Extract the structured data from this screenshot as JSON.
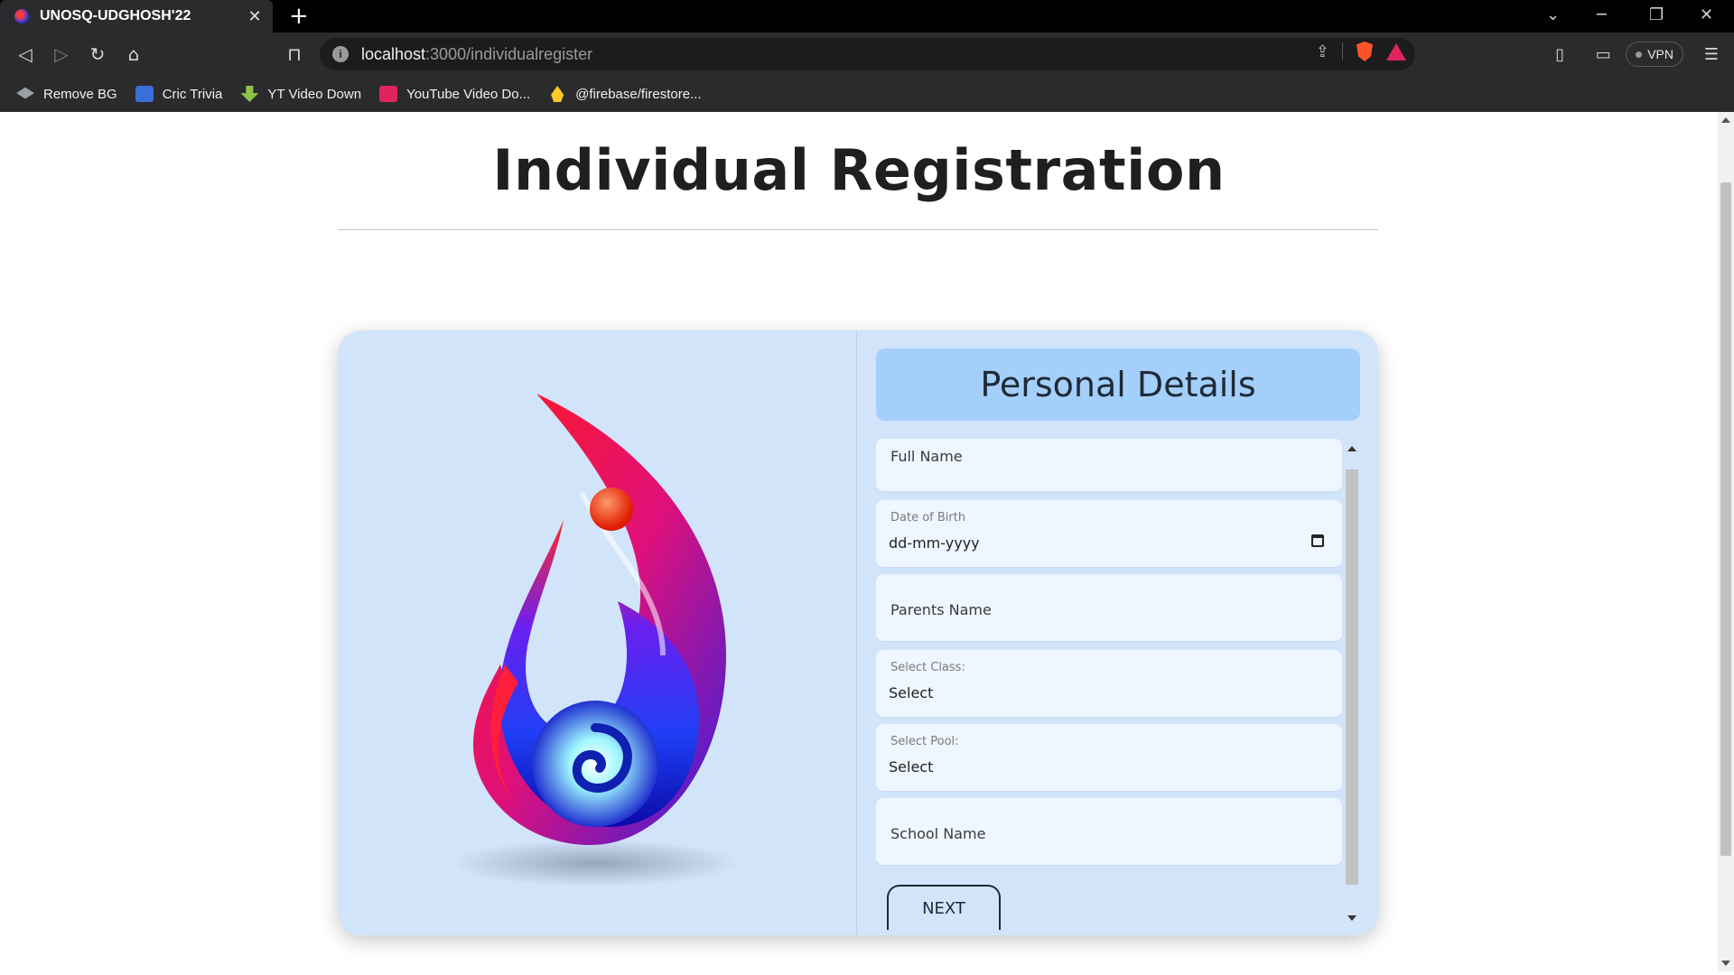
{
  "browser": {
    "tab_title": "UNOSQ-UDGHOSH'22",
    "url_host": "localhost",
    "url_path": ":3000/individualregister",
    "vpn_label": "VPN",
    "bookmarks": [
      {
        "label": "Remove BG",
        "icon": "layers-icon",
        "color": "#9aa0a6"
      },
      {
        "label": "Cric Trivia",
        "icon": "cric-trivia-icon",
        "color": "#3b6fd8"
      },
      {
        "label": "YT Video Down",
        "icon": "download-arrow-icon",
        "color": "#8bc34a"
      },
      {
        "label": "YouTube Video Do...",
        "icon": "youtube-download-icon",
        "color": "#e0245e"
      },
      {
        "label": "@firebase/firestore...",
        "icon": "firebase-icon",
        "color": "#ffca28"
      }
    ]
  },
  "page": {
    "title": "Individual Registration",
    "section_header": "Personal Details",
    "fields": {
      "full_name": {
        "placeholder": "Full Name"
      },
      "dob": {
        "label": "Date of Birth",
        "value": "dd-mm-yyyy"
      },
      "parents_name": {
        "placeholder": "Parents Name"
      },
      "class": {
        "label": "Select Class:",
        "value": "Select"
      },
      "pool": {
        "label": "Select Pool:",
        "value": "Select"
      },
      "school_name": {
        "placeholder": "School Name"
      }
    },
    "next_label": "NEXT"
  },
  "colors": {
    "card_bg": "#d2e4fa",
    "header_bg": "#a4cffb",
    "field_bg": "#eef6ff"
  }
}
